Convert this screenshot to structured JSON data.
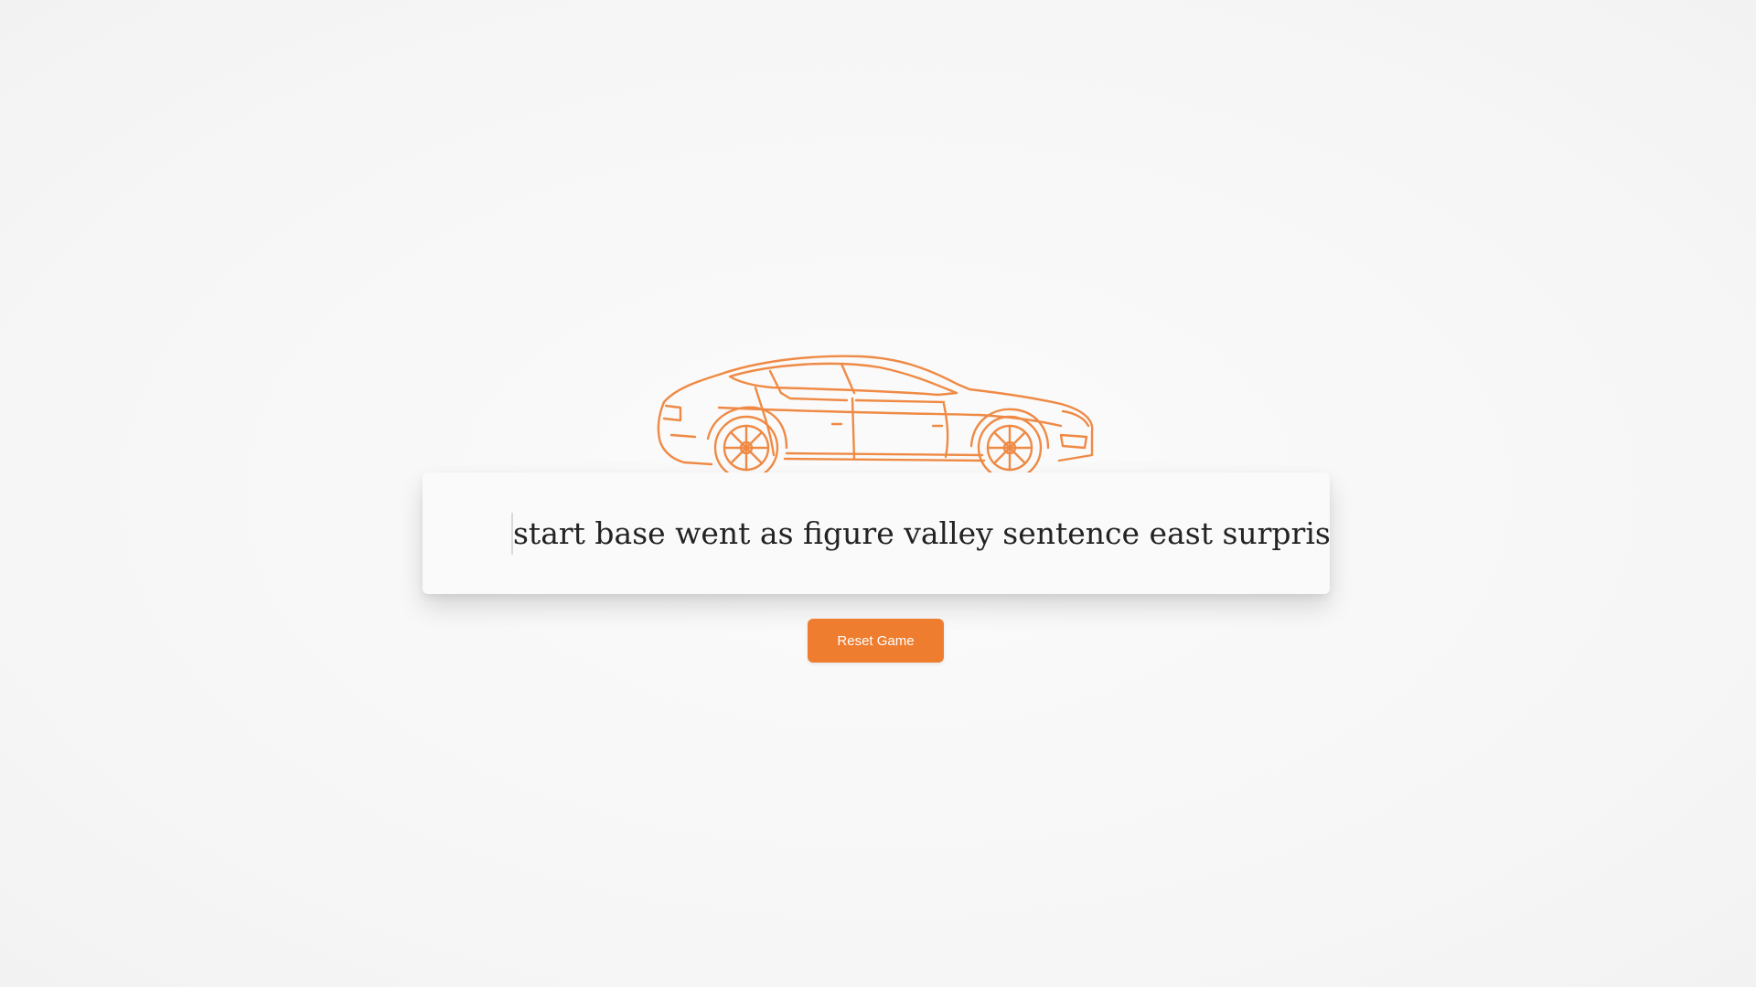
{
  "game": {
    "car_icon": "car-outline-icon",
    "word_stream": "start base went as figure valley sentence east surprise lar",
    "reset_label": "Reset Game"
  },
  "colors": {
    "accent": "#ef7d2f",
    "car_stroke": "#ef8a45",
    "text": "#232323",
    "background": "#f7f7f7",
    "card": "#fafafa"
  }
}
